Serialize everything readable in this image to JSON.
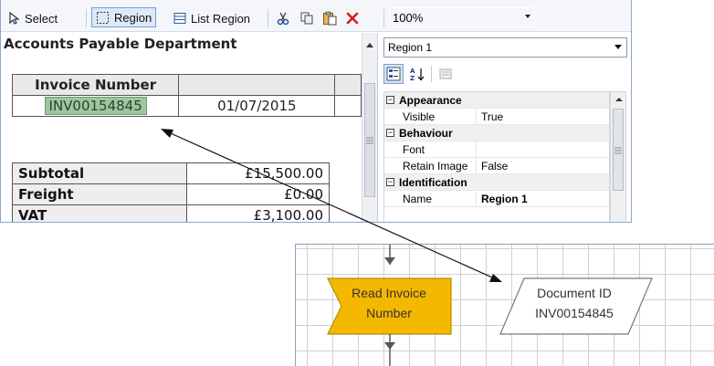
{
  "toolbar": {
    "select_label": "Select",
    "region_label": "Region",
    "list_region_label": "List Region",
    "zoom_value": "100%"
  },
  "document": {
    "title": "Accounts Payable Department",
    "invoice_header": "Invoice Number",
    "invoice_number": "INV00154845",
    "invoice_date": "01/07/2015",
    "totals": [
      {
        "label": "Subtotal",
        "value": "£15,500.00"
      },
      {
        "label": "Freight",
        "value": "£0.00"
      },
      {
        "label": "VAT",
        "value": "£3,100.00"
      }
    ]
  },
  "properties": {
    "selected_object": "Region 1",
    "categories": [
      {
        "name": "Appearance",
        "rows": [
          {
            "key": "Visible",
            "value": "True"
          }
        ]
      },
      {
        "name": "Behaviour",
        "rows": [
          {
            "key": "Font",
            "value": ""
          },
          {
            "key": "Retain Image",
            "value": "False"
          }
        ]
      },
      {
        "name": "Identification",
        "rows": [
          {
            "key": "Name",
            "value": "Region 1"
          }
        ]
      }
    ]
  },
  "flowchart": {
    "read_stage_line1": "Read Invoice",
    "read_stage_line2": "Number",
    "data_item_line1": "Document ID",
    "data_item_line2": "INV00154845",
    "read_stage_color": "#f5b800"
  },
  "colors": {
    "accent": "#6f9ed6",
    "highlight_green": "#9fc79f",
    "delete_red": "#d42020"
  }
}
